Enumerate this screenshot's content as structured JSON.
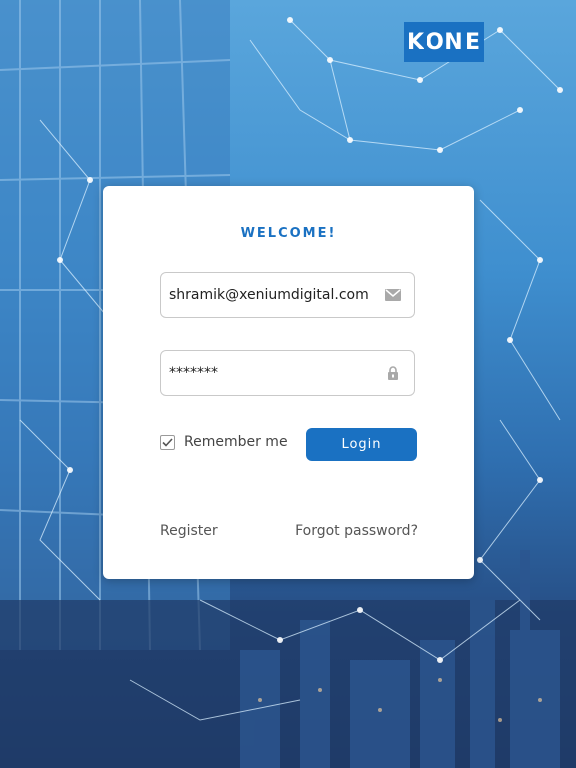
{
  "brand": {
    "letters": [
      "K",
      "O",
      "N",
      "E"
    ],
    "color": "#1a71c2"
  },
  "login": {
    "heading": "WELCOME!",
    "email_value": "shramik@xeniumdigital.com",
    "password_value": "*******",
    "remember_label": "Remember me",
    "remember_checked": true,
    "login_label": "Login",
    "register_label": "Register",
    "forgot_label": "Forgot password?"
  },
  "icons": {
    "email": "mail-icon",
    "password": "lock-icon",
    "checkbox": "check-icon"
  }
}
